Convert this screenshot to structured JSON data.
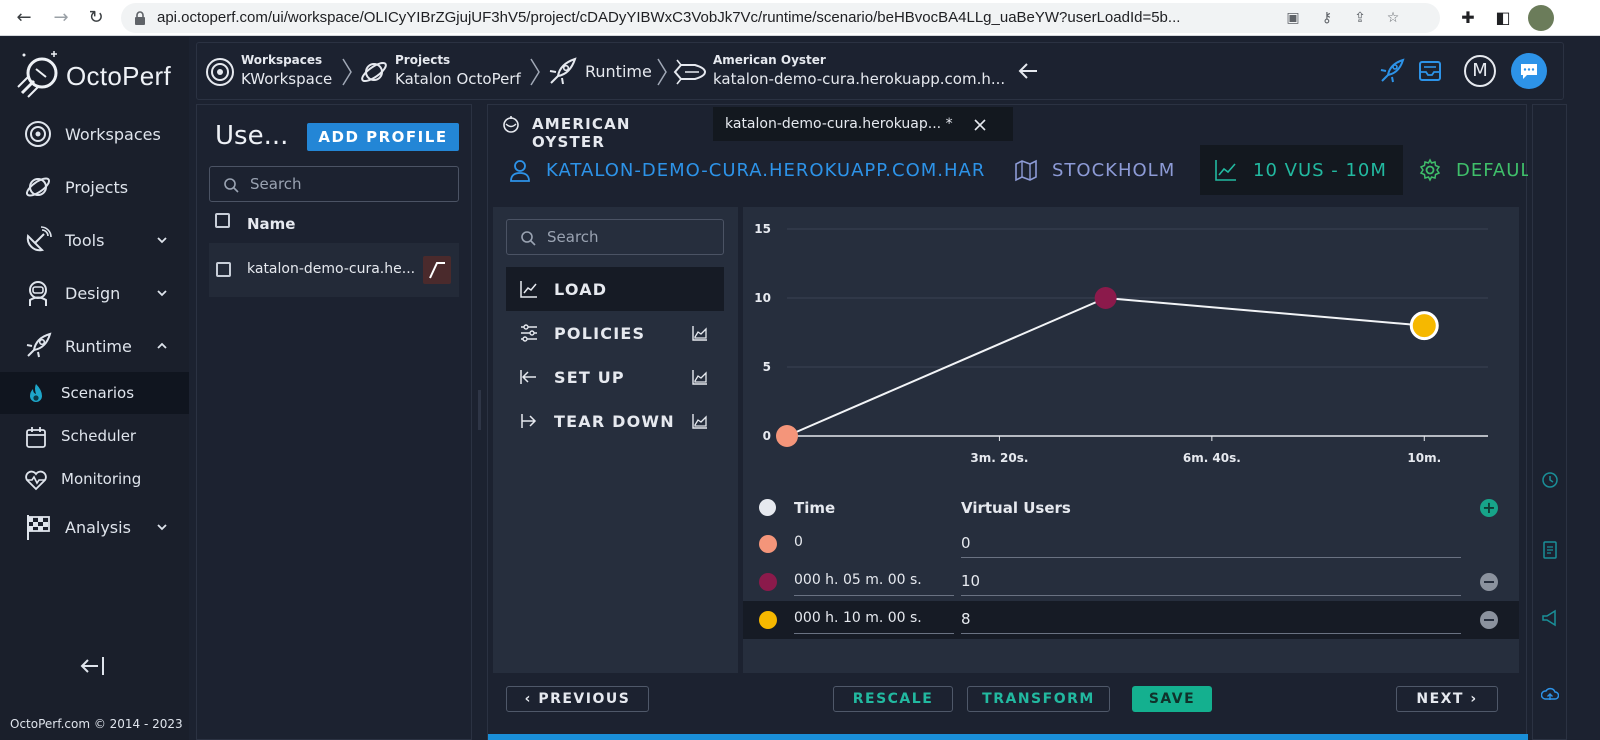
{
  "browser": {
    "url": "api.octoperf.com/ui/workspace/OLICyYIBrZGjujUF3hV5/project/cDADyYIBWxC3VobJk7Vc/runtime/scenario/beHBvocBA4LLg_uaBeYW?userLoadId=5b..."
  },
  "app": {
    "name": "OctoPerf"
  },
  "sidebar": {
    "items": [
      {
        "label": "Workspaces"
      },
      {
        "label": "Projects"
      },
      {
        "label": "Tools"
      },
      {
        "label": "Design"
      },
      {
        "label": "Runtime"
      },
      {
        "label": "Scenarios"
      },
      {
        "label": "Scheduler"
      },
      {
        "label": "Monitoring"
      },
      {
        "label": "Analysis"
      }
    ],
    "copyright": "OctoPerf.com © 2014 - 2023"
  },
  "breadcrumb": {
    "workspaces": {
      "small": "Workspaces",
      "big": "KWorkspace"
    },
    "projects": {
      "small": "Projects",
      "big": "Katalon OctoPerf"
    },
    "runtime": {
      "label": "Runtime"
    },
    "scenario": {
      "small": "American Oyster",
      "big": "katalon-demo-cura.herokuapp.com.h..."
    }
  },
  "header": {
    "user_initial": "M"
  },
  "profiles": {
    "title": "Use...",
    "add_button": "ADD PROFILE",
    "search_placeholder": "Search",
    "column_name": "Name",
    "rows": [
      {
        "label": "katalon-demo-cura.he..."
      }
    ]
  },
  "tabs": {
    "scenario_tab": "AMERICAN OYSTER",
    "profile_tab": "katalon-demo-cura.herokuap... *"
  },
  "ribbon": {
    "har": "KATALON-DEMO-CURA.HEROKUAPP.COM.HAR",
    "region": "STOCKHOLM",
    "load": "10 VUS - 10M",
    "settings": "DEFAUL"
  },
  "menu": {
    "search_placeholder": "Search",
    "items": [
      {
        "label": "LOAD"
      },
      {
        "label": "POLICIES"
      },
      {
        "label": "SET UP"
      },
      {
        "label": "TEAR DOWN"
      }
    ]
  },
  "chart_data": {
    "type": "line",
    "title": "",
    "xlabel": "",
    "ylabel": "",
    "x_ticks": [
      "3m. 20s.",
      "6m. 40s.",
      "10m."
    ],
    "y_ticks": [
      "0",
      "5",
      "10",
      "15"
    ],
    "xlim_seconds": [
      0,
      660
    ],
    "ylim": [
      0,
      15
    ],
    "grid": true,
    "series": [
      {
        "points": [
          {
            "x_seconds": 0,
            "y": 0,
            "color": "#f4957a"
          },
          {
            "x_seconds": 300,
            "y": 10,
            "color": "#8b1a4b"
          },
          {
            "x_seconds": 600,
            "y": 8,
            "color": "#f6b800"
          }
        ]
      }
    ]
  },
  "load_table": {
    "col_time": "Time",
    "col_vus": "Virtual Users",
    "rows": [
      {
        "time": "0",
        "vus": "0",
        "color": "#f4957a"
      },
      {
        "time": "000 h.   05 m.   00 s.",
        "vus": "10",
        "color": "#8b1a4b"
      },
      {
        "time": "000 h.   10 m.   00 s.",
        "vus": "8",
        "color": "#f6b800"
      }
    ]
  },
  "footer": {
    "previous": "PREVIOUS",
    "rescale": "RESCALE",
    "transform": "TRANSFORM",
    "save": "SAVE",
    "next": "NEXT"
  }
}
